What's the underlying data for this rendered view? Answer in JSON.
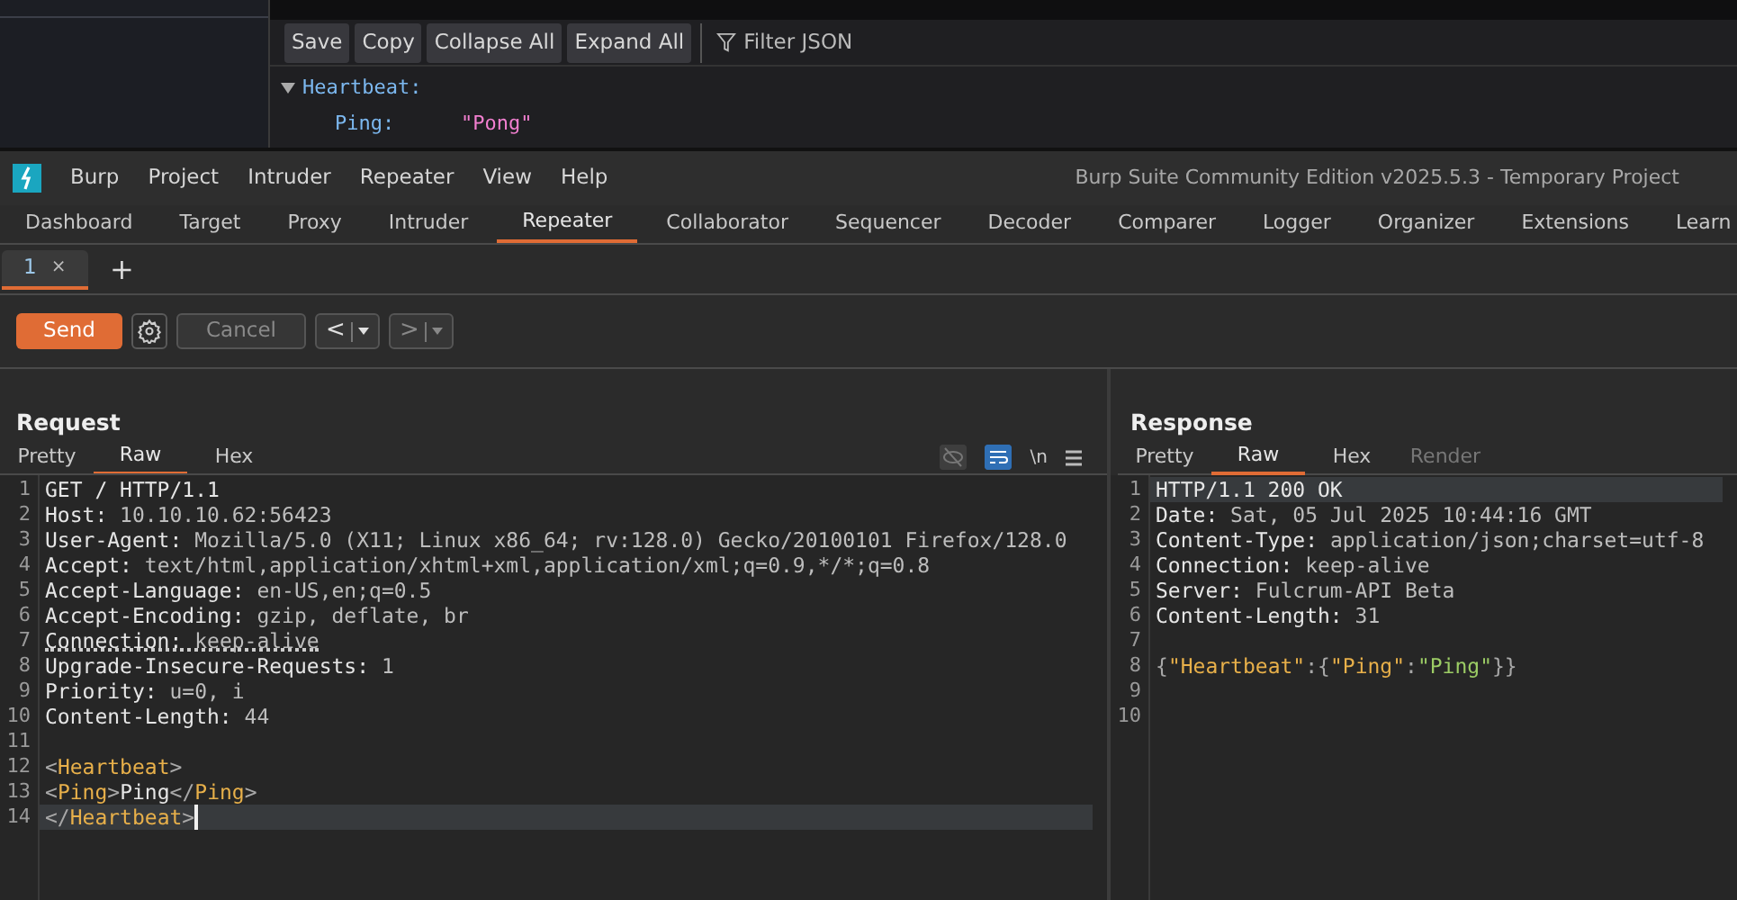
{
  "json_viewer": {
    "buttons": [
      "Save",
      "Copy",
      "Collapse All",
      "Expand All"
    ],
    "filter": {
      "placeholder": "Filter JSON"
    },
    "tree": [
      {
        "key": "Heartbeat:",
        "expanded": true,
        "children": [
          {
            "key": "Ping:",
            "value": "\"Pong\""
          }
        ]
      }
    ]
  },
  "app": {
    "menu": [
      "Burp",
      "Project",
      "Intruder",
      "Repeater",
      "View",
      "Help"
    ],
    "title": "Burp Suite Community Edition v2025.5.3 - Temporary Project",
    "tabs": [
      {
        "label": "Dashboard",
        "selected": false
      },
      {
        "label": "Target",
        "selected": false
      },
      {
        "label": "Proxy",
        "selected": false
      },
      {
        "label": "Intruder",
        "selected": false
      },
      {
        "label": "Repeater",
        "selected": true
      },
      {
        "label": "Collaborator",
        "selected": false
      },
      {
        "label": "Sequencer",
        "selected": false
      },
      {
        "label": "Decoder",
        "selected": false
      },
      {
        "label": "Comparer",
        "selected": false
      },
      {
        "label": "Logger",
        "selected": false
      },
      {
        "label": "Organizer",
        "selected": false
      },
      {
        "label": "Extensions",
        "selected": false
      },
      {
        "label": "Learn",
        "selected": false
      }
    ]
  },
  "repeater_tabs": [
    {
      "label": "1",
      "close": "×",
      "selected": true
    }
  ],
  "add_tab": "+",
  "toolbar": {
    "send": "Send",
    "cancel": {
      "label": "Cancel",
      "disabled": true
    },
    "back": {
      "label": "<",
      "disabled": false
    },
    "forward": {
      "label": ">",
      "disabled": true
    }
  },
  "request": {
    "title": "Request",
    "views": [
      {
        "label": "Pretty",
        "selected": false,
        "disabled": false
      },
      {
        "label": "Raw",
        "selected": true,
        "disabled": false
      },
      {
        "label": "Hex",
        "selected": false,
        "disabled": false
      }
    ],
    "toggles": [
      {
        "kind": "hide",
        "on": false
      },
      {
        "kind": "wrap",
        "on": true
      }
    ],
    "newline_label": "\\n",
    "lines": [
      {
        "n": "1",
        "current": false,
        "cursor": false,
        "underlined": false,
        "segments": [
          {
            "kind": "name",
            "text": "GET / HTTP/1.1"
          }
        ]
      },
      {
        "n": "2",
        "current": false,
        "cursor": false,
        "underlined": false,
        "segments": [
          {
            "kind": "name",
            "text": "Host:"
          },
          {
            "kind": "value",
            "text": " 10.10.10.62:56423"
          }
        ]
      },
      {
        "n": "3",
        "current": false,
        "cursor": false,
        "underlined": false,
        "segments": [
          {
            "kind": "name",
            "text": "User-Agent:"
          },
          {
            "kind": "value",
            "text": " Mozilla/5.0 (X11; Linux x86_64; rv:128.0) Gecko/20100101 Firefox/128.0"
          }
        ]
      },
      {
        "n": "4",
        "current": false,
        "cursor": false,
        "underlined": false,
        "segments": [
          {
            "kind": "name",
            "text": "Accept:"
          },
          {
            "kind": "value",
            "text": " text/html,application/xhtml+xml,application/xml;q=0.9,*/*;q=0.8"
          }
        ]
      },
      {
        "n": "5",
        "current": false,
        "cursor": false,
        "underlined": false,
        "segments": [
          {
            "kind": "name",
            "text": "Accept-Language:"
          },
          {
            "kind": "value",
            "text": " en-US,en;q=0.5"
          }
        ]
      },
      {
        "n": "6",
        "current": false,
        "cursor": false,
        "underlined": false,
        "segments": [
          {
            "kind": "name",
            "text": "Accept-Encoding:"
          },
          {
            "kind": "value",
            "text": " gzip, deflate, br"
          }
        ]
      },
      {
        "n": "7",
        "current": false,
        "cursor": false,
        "underlined": true,
        "segments": [
          {
            "kind": "name",
            "text": "Connection:"
          },
          {
            "kind": "value",
            "text": " keep-alive"
          }
        ]
      },
      {
        "n": "8",
        "current": false,
        "cursor": false,
        "underlined": false,
        "segments": [
          {
            "kind": "name",
            "text": "Upgrade-Insecure-Requests:"
          },
          {
            "kind": "value",
            "text": " 1"
          }
        ]
      },
      {
        "n": "9",
        "current": false,
        "cursor": false,
        "underlined": false,
        "segments": [
          {
            "kind": "name",
            "text": "Priority:"
          },
          {
            "kind": "value",
            "text": " u=0, i"
          }
        ]
      },
      {
        "n": "10",
        "current": false,
        "cursor": false,
        "underlined": false,
        "segments": [
          {
            "kind": "name",
            "text": "Content-Length:"
          },
          {
            "kind": "value",
            "text": " 44"
          }
        ]
      },
      {
        "n": "11",
        "current": false,
        "cursor": false
      },
      {
        "n": "12",
        "current": false,
        "cursor": false,
        "underlined": false,
        "segments": [
          {
            "kind": "punct",
            "text": "<"
          },
          {
            "kind": "tag",
            "text": "Heartbeat"
          },
          {
            "kind": "punct",
            "text": ">"
          }
        ]
      },
      {
        "n": "13",
        "current": false,
        "cursor": false,
        "underlined": false,
        "segments": [
          {
            "kind": "punct",
            "text": "<"
          },
          {
            "kind": "tag",
            "text": "Ping"
          },
          {
            "kind": "punct",
            "text": ">"
          },
          {
            "kind": "name",
            "text": "Ping"
          },
          {
            "kind": "punct",
            "text": "</"
          },
          {
            "kind": "tag",
            "text": "Ping"
          },
          {
            "kind": "punct",
            "text": ">"
          }
        ]
      },
      {
        "n": "14",
        "current": true,
        "cursor": true,
        "underlined": false,
        "segments": [
          {
            "kind": "punct",
            "text": "</"
          },
          {
            "kind": "tag",
            "text": "Heartbeat"
          },
          {
            "kind": "punct",
            "text": ">"
          }
        ]
      }
    ]
  },
  "response": {
    "title": "Response",
    "views": [
      {
        "label": "Pretty",
        "selected": false,
        "disabled": false
      },
      {
        "label": "Raw",
        "selected": true,
        "disabled": false
      },
      {
        "label": "Hex",
        "selected": false,
        "disabled": false
      },
      {
        "label": "Render",
        "selected": false,
        "disabled": true
      }
    ],
    "lines": [
      {
        "n": "1",
        "current": true,
        "cursor": false,
        "underlined": false,
        "segments": [
          {
            "kind": "name",
            "text": "HTTP/1.1 200 OK"
          }
        ]
      },
      {
        "n": "2",
        "current": false,
        "cursor": false,
        "underlined": false,
        "segments": [
          {
            "kind": "name",
            "text": "Date:"
          },
          {
            "kind": "value",
            "text": " Sat, 05 Jul 2025 10:44:16 GMT"
          }
        ]
      },
      {
        "n": "3",
        "current": false,
        "cursor": false,
        "underlined": false,
        "segments": [
          {
            "kind": "name",
            "text": "Content-Type:"
          },
          {
            "kind": "value",
            "text": " application/json;charset=utf-8"
          }
        ]
      },
      {
        "n": "4",
        "current": false,
        "cursor": false,
        "underlined": false,
        "segments": [
          {
            "kind": "name",
            "text": "Connection:"
          },
          {
            "kind": "value",
            "text": " keep-alive"
          }
        ]
      },
      {
        "n": "5",
        "current": false,
        "cursor": false,
        "underlined": false,
        "segments": [
          {
            "kind": "name",
            "text": "Server:"
          },
          {
            "kind": "value",
            "text": " Fulcrum-API Beta"
          }
        ]
      },
      {
        "n": "6",
        "current": false,
        "cursor": false,
        "underlined": false,
        "segments": [
          {
            "kind": "name",
            "text": "Content-Length:"
          },
          {
            "kind": "value",
            "text": " 31"
          }
        ]
      },
      {
        "n": "7",
        "current": false,
        "cursor": false
      },
      {
        "n": "8",
        "current": false,
        "cursor": false,
        "underlined": false,
        "segments": [
          {
            "kind": "punct",
            "text": "{"
          },
          {
            "kind": "key",
            "text": "\"Heartbeat\""
          },
          {
            "kind": "punct",
            "text": ":{"
          },
          {
            "kind": "key",
            "text": "\"Ping\""
          },
          {
            "kind": "punct",
            "text": ":"
          },
          {
            "kind": "string",
            "text": "\"Ping\""
          },
          {
            "kind": "punct",
            "text": "}}"
          }
        ]
      },
      {
        "n": "9",
        "current": false,
        "cursor": false
      },
      {
        "n": "10",
        "current": false,
        "cursor": false
      }
    ]
  }
}
